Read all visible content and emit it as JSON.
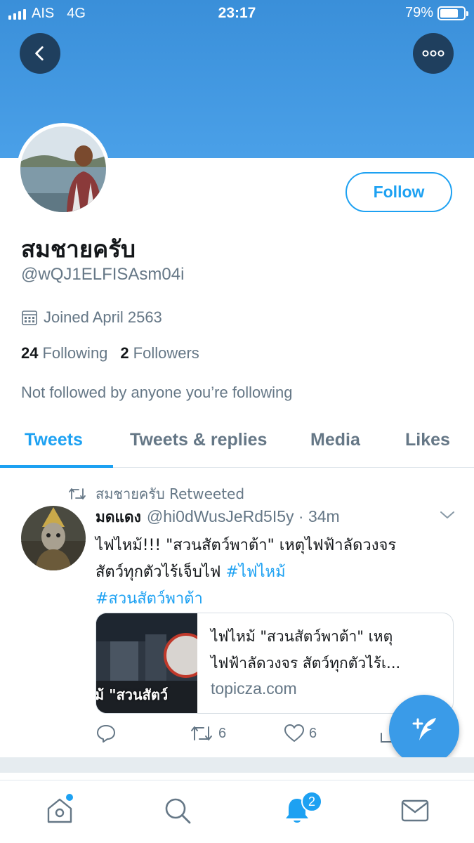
{
  "status_bar": {
    "carrier": "AIS",
    "network": "4G",
    "time": "23:17",
    "battery_percent": "79%",
    "battery_level": 0.79
  },
  "header": {
    "back_icon": "chevron-left-icon",
    "more_icon": "more-horizontal-icon"
  },
  "profile": {
    "display_name": "สมชายครับ",
    "handle": "@wQJ1ELFISAsm04i",
    "follow_label": "Follow",
    "joined": "Joined April 2563",
    "following_count": "24",
    "following_label": "Following",
    "followers_count": "2",
    "followers_label": "Followers",
    "not_followed": "Not followed by anyone you’re following"
  },
  "tabs": [
    {
      "label": "Tweets",
      "active": true
    },
    {
      "label": "Tweets & replies",
      "active": false
    },
    {
      "label": "Media",
      "active": false
    },
    {
      "label": "Likes",
      "active": false
    }
  ],
  "tweet": {
    "retweeted_by": "สมชายครับ Retweeted",
    "author_name": "มดแดง",
    "author_handle": "@hi0dWusJeRd5I5y",
    "separator": "·",
    "time": "34m",
    "text_line1": "ไฟไหม้!!! \"สวนสัตว์พาต้า\" เหตุไฟฟ้าลัดวงจร",
    "text_line2_plain": "สัตว์ทุกตัวไร้เจ็บไฟ ",
    "hashtag1": "#ไฟไหม้",
    "hashtag2": "#สวนสัตว์พาต้า",
    "card": {
      "title_line1": "ไฟไหม้ \"สวนสัตว์พาต้า\" เหตุ",
      "title_line2": "ไฟฟ้าลัดวงจร สัตว์ทุกตัวไร้เ...",
      "domain": "topicza.com",
      "image_caption": "ม้ \"สวนสัตว์"
    },
    "reply_count": "",
    "retweet_count": "6",
    "like_count": "6"
  },
  "bottom_nav": {
    "items": [
      "home-icon",
      "search-icon",
      "notifications-icon",
      "messages-icon"
    ],
    "notification_badge": "2"
  },
  "colors": {
    "accent": "#1da1f2",
    "header": "#4aa0e8",
    "round_button": "#1f3f5e",
    "secondary_text": "#657786"
  }
}
